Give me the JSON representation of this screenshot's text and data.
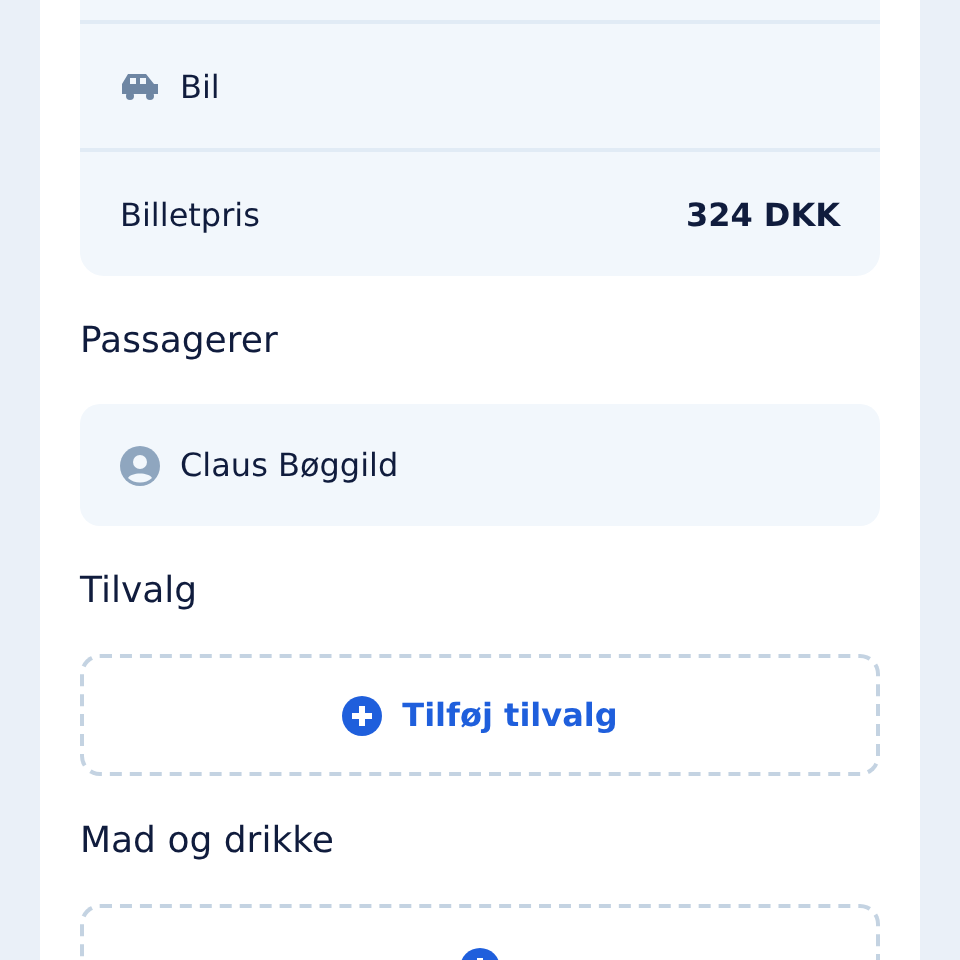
{
  "trip_summary": {
    "rows": [
      {
        "kind": "vehicle",
        "label": "Bil"
      },
      {
        "kind": "price",
        "label": "Billetpris",
        "value": "324 DKK"
      }
    ]
  },
  "sections": [
    {
      "kind": "passengers",
      "title": "Passagerer",
      "passengers": [
        {
          "name": "Claus Bøggild"
        }
      ]
    },
    {
      "kind": "add",
      "title": "Tilvalg",
      "button": "Tilføj tilvalg"
    },
    {
      "kind": "add",
      "title": "Mad og drikke"
    }
  ]
}
